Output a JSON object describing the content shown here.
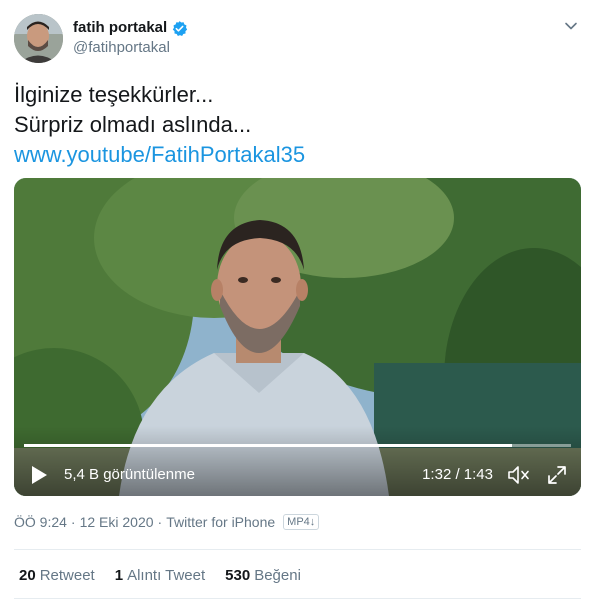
{
  "author": {
    "display_name": "fatih portakal",
    "handle": "@fatihportakal",
    "verified": true
  },
  "tweet": {
    "line1": "İlginize teşekkürler...",
    "line2": "Sürpriz olmadı aslında...",
    "link": "www.youtube/FatihPortakal35"
  },
  "video": {
    "views": "5,4 B görüntülenme",
    "time": "1:32 / 1:43",
    "progress": 0.893
  },
  "meta": {
    "time": "ÖÖ 9:24",
    "date": "12 Eki 2020",
    "source": "Twitter for iPhone",
    "badge": "MP4↓"
  },
  "stats": {
    "retweets_count": "20",
    "retweets_label": "Retweet",
    "quotes_count": "1",
    "quotes_label": "Alıntı Tweet",
    "likes_count": "530",
    "likes_label": "Beğeni"
  },
  "colors": {
    "link": "#1b95e0",
    "verified": "#1da1f2",
    "secondary_text": "#657786"
  },
  "icons": [
    "verified-icon",
    "chevron-down-icon",
    "play-icon",
    "volume-icon",
    "fullscreen-icon"
  ]
}
